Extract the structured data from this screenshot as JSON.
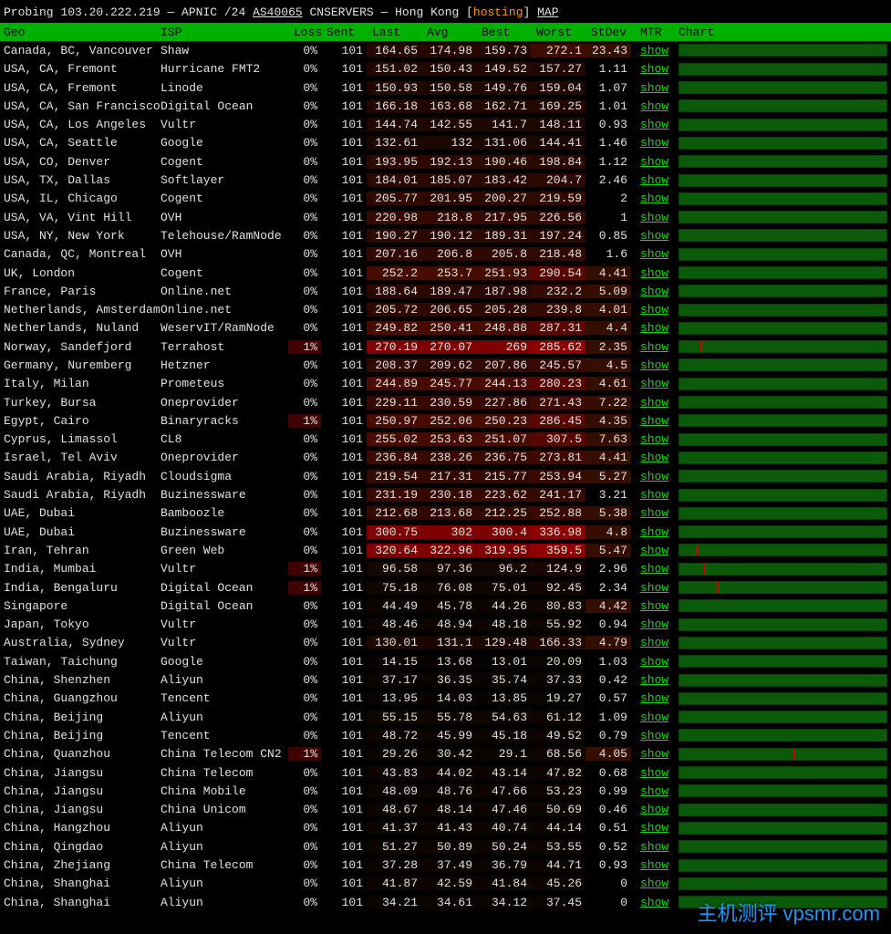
{
  "header": {
    "prefix": "Probing ",
    "ip": "103.20.222.219",
    "sep1": " — APNIC /24 ",
    "asn": "AS40065",
    "sep2": " CNSERVERS — Hong Kong [",
    "hosting": "hosting",
    "sep3": "] ",
    "map": "MAP"
  },
  "columns": [
    "Geo",
    "ISP",
    "Loss",
    "Sent",
    "Last",
    "Avg",
    "Best",
    "Worst",
    "StDev",
    "MTR",
    "Chart"
  ],
  "mtr_label": "show",
  "watermark": "主机测评 vpsmr.com",
  "rows": [
    {
      "geo": "Canada, BC, Vancouver",
      "isp": "Shaw",
      "loss": "0%",
      "sent": "101",
      "last": "164.65",
      "avg": "174.98",
      "best": "159.73",
      "worst": "272.1",
      "stdev": "23.43",
      "h": 0
    },
    {
      "geo": "USA, CA, Fremont",
      "isp": "Hurricane FMT2",
      "loss": "0%",
      "sent": "101",
      "last": "151.02",
      "avg": "150.43",
      "best": "149.52",
      "worst": "157.27",
      "stdev": "1.11",
      "h": 0
    },
    {
      "geo": "USA, CA, Fremont",
      "isp": "Linode",
      "loss": "0%",
      "sent": "101",
      "last": "150.93",
      "avg": "150.58",
      "best": "149.76",
      "worst": "159.04",
      "stdev": "1.07",
      "h": 0
    },
    {
      "geo": "USA, CA, San Francisco",
      "isp": "Digital Ocean",
      "loss": "0%",
      "sent": "101",
      "last": "166.18",
      "avg": "163.68",
      "best": "162.71",
      "worst": "169.25",
      "stdev": "1.01",
      "h": 0
    },
    {
      "geo": "USA, CA, Los Angeles",
      "isp": "Vultr",
      "loss": "0%",
      "sent": "101",
      "last": "144.74",
      "avg": "142.55",
      "best": "141.7",
      "worst": "148.11",
      "stdev": "0.93",
      "h": 0
    },
    {
      "geo": "USA, CA, Seattle",
      "isp": "Google",
      "loss": "0%",
      "sent": "101",
      "last": "132.61",
      "avg": "132",
      "best": "131.06",
      "worst": "144.41",
      "stdev": "1.46",
      "h": 0
    },
    {
      "geo": "USA, CO, Denver",
      "isp": "Cogent",
      "loss": "0%",
      "sent": "101",
      "last": "193.95",
      "avg": "192.13",
      "best": "190.46",
      "worst": "198.84",
      "stdev": "1.12",
      "h": 0
    },
    {
      "geo": "USA, TX, Dallas",
      "isp": "Softlayer",
      "loss": "0%",
      "sent": "101",
      "last": "184.01",
      "avg": "185.07",
      "best": "183.42",
      "worst": "204.7",
      "stdev": "2.46",
      "h": 0
    },
    {
      "geo": "USA, IL, Chicago",
      "isp": "Cogent",
      "loss": "0%",
      "sent": "101",
      "last": "205.77",
      "avg": "201.95",
      "best": "200.27",
      "worst": "219.59",
      "stdev": "2",
      "h": 0
    },
    {
      "geo": "USA, VA, Vint Hill",
      "isp": "OVH",
      "loss": "0%",
      "sent": "101",
      "last": "220.98",
      "avg": "218.8",
      "best": "217.95",
      "worst": "226.56",
      "stdev": "1",
      "h": 0
    },
    {
      "geo": "USA, NY, New York",
      "isp": "Telehouse/RamNode",
      "loss": "0%",
      "sent": "101",
      "last": "190.27",
      "avg": "190.12",
      "best": "189.31",
      "worst": "197.24",
      "stdev": "0.85",
      "h": 0
    },
    {
      "geo": "Canada, QC, Montreal",
      "isp": "OVH",
      "loss": "0%",
      "sent": "101",
      "last": "207.16",
      "avg": "206.8",
      "best": "205.8",
      "worst": "218.48",
      "stdev": "1.6",
      "h": 0
    },
    {
      "geo": "UK, London",
      "isp": "Cogent",
      "loss": "0%",
      "sent": "101",
      "last": "252.2",
      "avg": "253.7",
      "best": "251.93",
      "worst": "290.54",
      "stdev": "4.41",
      "h": 1
    },
    {
      "geo": "France, Paris",
      "isp": "Online.net",
      "loss": "0%",
      "sent": "101",
      "last": "188.64",
      "avg": "189.47",
      "best": "187.98",
      "worst": "232.2",
      "stdev": "5.09",
      "h": 0
    },
    {
      "geo": "Netherlands, Amsterdam",
      "isp": "Online.net",
      "loss": "0%",
      "sent": "101",
      "last": "205.72",
      "avg": "206.65",
      "best": "205.28",
      "worst": "239.8",
      "stdev": "4.01",
      "h": 0
    },
    {
      "geo": "Netherlands, Nuland",
      "isp": "WeservIT/RamNode",
      "loss": "0%",
      "sent": "101",
      "last": "249.82",
      "avg": "250.41",
      "best": "248.88",
      "worst": "287.31",
      "stdev": "4.4",
      "h": 1
    },
    {
      "geo": "Norway, Sandefjord",
      "isp": "Terrahost",
      "loss": "1%",
      "sent": "101",
      "last": "270.19",
      "avg": "270.07",
      "best": "269",
      "worst": "285.62",
      "stdev": "2.35",
      "h": 2,
      "loss1": true,
      "rp": "10%"
    },
    {
      "geo": "Germany, Nuremberg",
      "isp": "Hetzner",
      "loss": "0%",
      "sent": "101",
      "last": "208.37",
      "avg": "209.62",
      "best": "207.86",
      "worst": "245.57",
      "stdev": "4.5",
      "h": 0
    },
    {
      "geo": "Italy, Milan",
      "isp": "Prometeus",
      "loss": "0%",
      "sent": "101",
      "last": "244.89",
      "avg": "245.77",
      "best": "244.13",
      "worst": "280.23",
      "stdev": "4.61",
      "h": 1
    },
    {
      "geo": "Turkey, Bursa",
      "isp": "Oneprovider",
      "loss": "0%",
      "sent": "101",
      "last": "229.11",
      "avg": "230.59",
      "best": "227.86",
      "worst": "271.43",
      "stdev": "7.22",
      "h": 0
    },
    {
      "geo": "Egypt, Cairo",
      "isp": "Binaryracks",
      "loss": "1%",
      "sent": "101",
      "last": "250.97",
      "avg": "252.06",
      "best": "250.23",
      "worst": "286.45",
      "stdev": "4.35",
      "h": 1,
      "loss1": true
    },
    {
      "geo": "Cyprus, Limassol",
      "isp": "CL8",
      "loss": "0%",
      "sent": "101",
      "last": "255.02",
      "avg": "253.63",
      "best": "251.07",
      "worst": "307.5",
      "stdev": "7.63",
      "h": 1
    },
    {
      "geo": "Israel, Tel Aviv",
      "isp": "Oneprovider",
      "loss": "0%",
      "sent": "101",
      "last": "236.84",
      "avg": "238.26",
      "best": "236.75",
      "worst": "273.81",
      "stdev": "4.41",
      "h": 0
    },
    {
      "geo": "Saudi Arabia, Riyadh",
      "isp": "Cloudsigma",
      "loss": "0%",
      "sent": "101",
      "last": "219.54",
      "avg": "217.31",
      "best": "215.77",
      "worst": "253.94",
      "stdev": "5.27",
      "h": 0
    },
    {
      "geo": "Saudi Arabia, Riyadh",
      "isp": "Buzinessware",
      "loss": "0%",
      "sent": "101",
      "last": "231.19",
      "avg": "230.18",
      "best": "223.62",
      "worst": "241.17",
      "stdev": "3.21",
      "h": 0
    },
    {
      "geo": "UAE, Dubai",
      "isp": "Bamboozle",
      "loss": "0%",
      "sent": "101",
      "last": "212.68",
      "avg": "213.68",
      "best": "212.25",
      "worst": "252.88",
      "stdev": "5.38",
      "h": 0
    },
    {
      "geo": "UAE, Dubai",
      "isp": "Buzinessware",
      "loss": "0%",
      "sent": "101",
      "last": "300.75",
      "avg": "302",
      "best": "300.4",
      "worst": "336.98",
      "stdev": "4.8",
      "h": 2
    },
    {
      "geo": "Iran, Tehran",
      "isp": "Green Web",
      "loss": "0%",
      "sent": "101",
      "last": "320.64",
      "avg": "322.96",
      "best": "319.95",
      "worst": "359.5",
      "stdev": "5.47",
      "h": 2,
      "rp": "8%"
    },
    {
      "geo": "India, Mumbai",
      "isp": "Vultr",
      "loss": "1%",
      "sent": "101",
      "last": "96.58",
      "avg": "97.36",
      "best": "96.2",
      "worst": "124.9",
      "stdev": "2.96",
      "h": 0,
      "loss1": true,
      "rp": "12%"
    },
    {
      "geo": "India, Bengaluru",
      "isp": "Digital Ocean",
      "loss": "1%",
      "sent": "101",
      "last": "75.18",
      "avg": "76.08",
      "best": "75.01",
      "worst": "92.45",
      "stdev": "2.34",
      "h": 0,
      "loss1": true,
      "rp": "18%"
    },
    {
      "geo": "Singapore",
      "isp": "Digital Ocean",
      "loss": "0%",
      "sent": "101",
      "last": "44.49",
      "avg": "45.78",
      "best": "44.26",
      "worst": "80.83",
      "stdev": "4.42",
      "h": 0
    },
    {
      "geo": "Japan, Tokyo",
      "isp": "Vultr",
      "loss": "0%",
      "sent": "101",
      "last": "48.46",
      "avg": "48.94",
      "best": "48.18",
      "worst": "55.92",
      "stdev": "0.94",
      "h": 0
    },
    {
      "geo": "Australia, Sydney",
      "isp": "Vultr",
      "loss": "0%",
      "sent": "101",
      "last": "130.01",
      "avg": "131.1",
      "best": "129.48",
      "worst": "166.33",
      "stdev": "4.79",
      "h": 0
    },
    {
      "geo": "Taiwan, Taichung",
      "isp": "Google",
      "loss": "0%",
      "sent": "101",
      "last": "14.15",
      "avg": "13.68",
      "best": "13.01",
      "worst": "20.09",
      "stdev": "1.03",
      "h": 0
    },
    {
      "geo": "China, Shenzhen",
      "isp": "Aliyun",
      "loss": "0%",
      "sent": "101",
      "last": "37.17",
      "avg": "36.35",
      "best": "35.74",
      "worst": "37.33",
      "stdev": "0.42",
      "h": 0
    },
    {
      "geo": "China, Guangzhou",
      "isp": "Tencent",
      "loss": "0%",
      "sent": "101",
      "last": "13.95",
      "avg": "14.03",
      "best": "13.85",
      "worst": "19.27",
      "stdev": "0.57",
      "h": 0
    },
    {
      "geo": "China, Beijing",
      "isp": "Aliyun",
      "loss": "0%",
      "sent": "101",
      "last": "55.15",
      "avg": "55.78",
      "best": "54.63",
      "worst": "61.12",
      "stdev": "1.09",
      "h": 0
    },
    {
      "geo": "China, Beijing",
      "isp": "Tencent",
      "loss": "0%",
      "sent": "101",
      "last": "48.72",
      "avg": "45.99",
      "best": "45.18",
      "worst": "49.52",
      "stdev": "0.79",
      "h": 0
    },
    {
      "geo": "China, Quanzhou",
      "isp": "China Telecom CN2",
      "loss": "1%",
      "sent": "101",
      "last": "29.26",
      "avg": "30.42",
      "best": "29.1",
      "worst": "68.56",
      "stdev": "4.05",
      "h": 0,
      "loss1": true,
      "rp": "55%"
    },
    {
      "geo": "China, Jiangsu",
      "isp": "China Telecom",
      "loss": "0%",
      "sent": "101",
      "last": "43.83",
      "avg": "44.02",
      "best": "43.14",
      "worst": "47.82",
      "stdev": "0.68",
      "h": 0
    },
    {
      "geo": "China, Jiangsu",
      "isp": "China Mobile",
      "loss": "0%",
      "sent": "101",
      "last": "48.09",
      "avg": "48.76",
      "best": "47.66",
      "worst": "53.23",
      "stdev": "0.99",
      "h": 0
    },
    {
      "geo": "China, Jiangsu",
      "isp": "China Unicom",
      "loss": "0%",
      "sent": "101",
      "last": "48.67",
      "avg": "48.14",
      "best": "47.46",
      "worst": "50.69",
      "stdev": "0.46",
      "h": 0
    },
    {
      "geo": "China, Hangzhou",
      "isp": "Aliyun",
      "loss": "0%",
      "sent": "101",
      "last": "41.37",
      "avg": "41.43",
      "best": "40.74",
      "worst": "44.14",
      "stdev": "0.51",
      "h": 0
    },
    {
      "geo": "China, Qingdao",
      "isp": "Aliyun",
      "loss": "0%",
      "sent": "101",
      "last": "51.27",
      "avg": "50.89",
      "best": "50.24",
      "worst": "53.55",
      "stdev": "0.52",
      "h": 0
    },
    {
      "geo": "China, Zhejiang",
      "isp": "China Telecom",
      "loss": "0%",
      "sent": "101",
      "last": "37.28",
      "avg": "37.49",
      "best": "36.79",
      "worst": "44.71",
      "stdev": "0.93",
      "h": 0
    },
    {
      "geo": "China, Shanghai",
      "isp": "Aliyun",
      "loss": "0%",
      "sent": "101",
      "last": "41.87",
      "avg": "42.59",
      "best": "41.84",
      "worst": "45.26",
      "stdev": "0",
      "h": 0
    },
    {
      "geo": "China, Shanghai",
      "isp": "Aliyun",
      "loss": "0%",
      "sent": "101",
      "last": "34.21",
      "avg": "34.61",
      "best": "34.12",
      "worst": "37.45",
      "stdev": "0",
      "h": 0
    }
  ]
}
